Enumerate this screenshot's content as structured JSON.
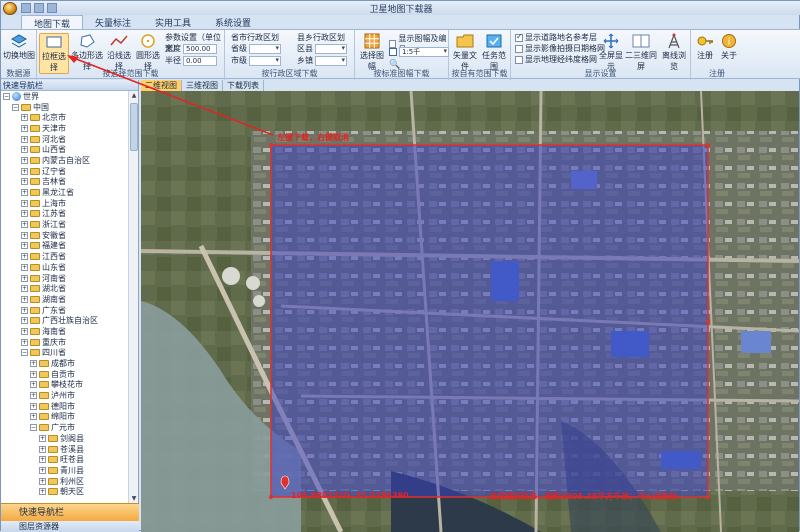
{
  "window": {
    "title": "卫星地图下载器"
  },
  "tabs": [
    "地图下载",
    "矢量标注",
    "实用工具",
    "系统设置"
  ],
  "ribbon": {
    "switch_map": "切换地图",
    "data_source_group": "数据源",
    "rect_select": "拉框选择",
    "polygon_select": "多边形选择",
    "line_select": "沿线选择",
    "circle_select": "圆形选择",
    "param_title": "参数设置（单位米）",
    "width_label": "宽度",
    "width_value": "500.00",
    "radius_label": "半径",
    "radius_value": "0.00",
    "select_group": "按选择范围下载",
    "city_title": "省市行政区划",
    "province_label": "省级",
    "city_label": "市级",
    "county_title": "县乡行政区划",
    "district_label": "区县",
    "town_label": "乡镇",
    "admin_group": "按行政区域下载",
    "sheet_select": "选择图幅",
    "show_sheet": "显示图幅及编号",
    "scale_value": "1:5千",
    "sheet_group": "按标准图幅下载",
    "vector_file": "矢量文件",
    "task_range": "任务范围",
    "custom_group": "按自有范围下载",
    "opt1": "显示道路地名参考层",
    "opt2": "显示影像拍摄日期格网",
    "opt3": "显示地理经纬度格网",
    "fullscreen": "全屏显示",
    "split_screen": "二三维同屏",
    "lab": "离线浏览",
    "display_group": "显示设置",
    "register": "注册",
    "about": "关于",
    "register_group": "注册"
  },
  "left_panel": {
    "title": "快速导航栏",
    "tree": [
      {
        "label": "世界",
        "level": 0,
        "exp": "−",
        "icon": "globe"
      },
      {
        "label": "中国",
        "level": 1,
        "exp": "−",
        "icon": "folder"
      },
      {
        "label": "北京市",
        "level": 2,
        "exp": "+",
        "icon": "folder"
      },
      {
        "label": "天津市",
        "level": 2,
        "exp": "+",
        "icon": "folder"
      },
      {
        "label": "河北省",
        "level": 2,
        "exp": "+",
        "icon": "folder"
      },
      {
        "label": "山西省",
        "level": 2,
        "exp": "+",
        "icon": "folder"
      },
      {
        "label": "内蒙古自治区",
        "level": 2,
        "exp": "+",
        "icon": "folder"
      },
      {
        "label": "辽宁省",
        "level": 2,
        "exp": "+",
        "icon": "folder"
      },
      {
        "label": "吉林省",
        "level": 2,
        "exp": "+",
        "icon": "folder"
      },
      {
        "label": "黑龙江省",
        "level": 2,
        "exp": "+",
        "icon": "folder"
      },
      {
        "label": "上海市",
        "level": 2,
        "exp": "+",
        "icon": "folder"
      },
      {
        "label": "江苏省",
        "level": 2,
        "exp": "+",
        "icon": "folder"
      },
      {
        "label": "浙江省",
        "level": 2,
        "exp": "+",
        "icon": "folder"
      },
      {
        "label": "安徽省",
        "level": 2,
        "exp": "+",
        "icon": "folder"
      },
      {
        "label": "福建省",
        "level": 2,
        "exp": "+",
        "icon": "folder"
      },
      {
        "label": "江西省",
        "level": 2,
        "exp": "+",
        "icon": "folder"
      },
      {
        "label": "山东省",
        "level": 2,
        "exp": "+",
        "icon": "folder"
      },
      {
        "label": "河南省",
        "level": 2,
        "exp": "+",
        "icon": "folder"
      },
      {
        "label": "湖北省",
        "level": 2,
        "exp": "+",
        "icon": "folder"
      },
      {
        "label": "湖南省",
        "level": 2,
        "exp": "+",
        "icon": "folder"
      },
      {
        "label": "广东省",
        "level": 2,
        "exp": "+",
        "icon": "folder"
      },
      {
        "label": "广西壮族自治区",
        "level": 2,
        "exp": "+",
        "icon": "folder"
      },
      {
        "label": "海南省",
        "level": 2,
        "exp": "+",
        "icon": "folder"
      },
      {
        "label": "重庆市",
        "level": 2,
        "exp": "+",
        "icon": "folder"
      },
      {
        "label": "四川省",
        "level": 2,
        "exp": "−",
        "icon": "folder"
      },
      {
        "label": "成都市",
        "level": 3,
        "exp": "+",
        "icon": "folder"
      },
      {
        "label": "自贡市",
        "level": 3,
        "exp": "+",
        "icon": "folder"
      },
      {
        "label": "攀枝花市",
        "level": 3,
        "exp": "+",
        "icon": "folder"
      },
      {
        "label": "泸州市",
        "level": 3,
        "exp": "+",
        "icon": "folder"
      },
      {
        "label": "德阳市",
        "level": 3,
        "exp": "+",
        "icon": "folder"
      },
      {
        "label": "绵阳市",
        "level": 3,
        "exp": "+",
        "icon": "folder"
      },
      {
        "label": "广元市",
        "level": 3,
        "exp": "−",
        "icon": "folder"
      },
      {
        "label": "剑阁县",
        "level": 4,
        "exp": "+",
        "icon": "folder"
      },
      {
        "label": "苍溪县",
        "level": 4,
        "exp": "+",
        "icon": "folder"
      },
      {
        "label": "旺苍县",
        "level": 4,
        "exp": "+",
        "icon": "folder"
      },
      {
        "label": "青川县",
        "level": 4,
        "exp": "+",
        "icon": "folder"
      },
      {
        "label": "利州区",
        "level": 4,
        "exp": "+",
        "icon": "folder"
      },
      {
        "label": "朝天区",
        "level": 4,
        "exp": "+",
        "icon": "folder"
      }
    ],
    "nav_button": "快速导航栏",
    "layer_button": "图层资源器"
  },
  "view_tabs": [
    "二维视图",
    "三维视图",
    "下载列表"
  ],
  "map": {
    "hint": "左键下载，右键取消",
    "coord_left": "104.8881310, 32.4286390",
    "status_right": "当前选区信息：面积3805.38平方千米；中心点坐标"
  },
  "colors": {
    "selection": "#3a3fc8",
    "selection_border": "#e03030",
    "annot": "#e02525"
  }
}
